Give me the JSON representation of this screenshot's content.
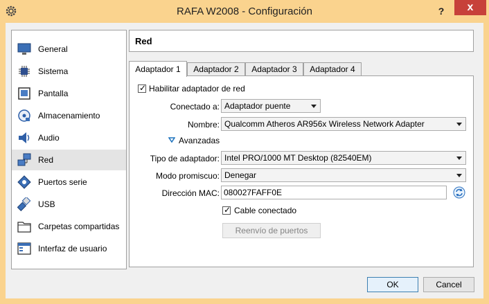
{
  "window": {
    "title": "RAFA W2008 - Configuración",
    "help": "?",
    "close": "x"
  },
  "sidebar": {
    "items": [
      {
        "label": "General",
        "icon": "monitor-icon"
      },
      {
        "label": "Sistema",
        "icon": "chip-icon"
      },
      {
        "label": "Pantalla",
        "icon": "display-icon"
      },
      {
        "label": "Almacenamiento",
        "icon": "disk-icon"
      },
      {
        "label": "Audio",
        "icon": "speaker-icon"
      },
      {
        "label": "Red",
        "icon": "network-icon"
      },
      {
        "label": "Puertos serie",
        "icon": "serial-port-icon"
      },
      {
        "label": "USB",
        "icon": "usb-icon"
      },
      {
        "label": "Carpetas compartidas",
        "icon": "folder-icon"
      },
      {
        "label": "Interfaz de usuario",
        "icon": "window-icon"
      }
    ],
    "selected_index": 5
  },
  "section": {
    "title": "Red"
  },
  "tabs": [
    {
      "label": "Adaptador 1"
    },
    {
      "label": "Adaptador 2"
    },
    {
      "label": "Adaptador 3"
    },
    {
      "label": "Adaptador 4"
    }
  ],
  "adapter": {
    "enable_label": "Habilitar adaptador de red",
    "enable_checked": true,
    "attached_label": "Conectado a:",
    "attached_value": "Adaptador puente",
    "name_label": "Nombre:",
    "name_value": "Qualcomm Atheros AR956x Wireless Network Adapter",
    "advanced_label": "Avanzadas",
    "type_label": "Tipo de adaptador:",
    "type_value": "Intel PRO/1000 MT Desktop (82540EM)",
    "promisc_label": "Modo promiscuo:",
    "promisc_value": "Denegar",
    "mac_label": "Dirección MAC:",
    "mac_value": "080027FAFF0E",
    "cable_label": "Cable conectado",
    "cable_checked": true,
    "port_forward_label": "Reenvío de puertos"
  },
  "footer": {
    "ok_label": "OK",
    "cancel_label": "Cancel"
  },
  "colors": {
    "titlebar": "#fad38e",
    "close": "#c7413a",
    "accent": "#1e73be"
  }
}
